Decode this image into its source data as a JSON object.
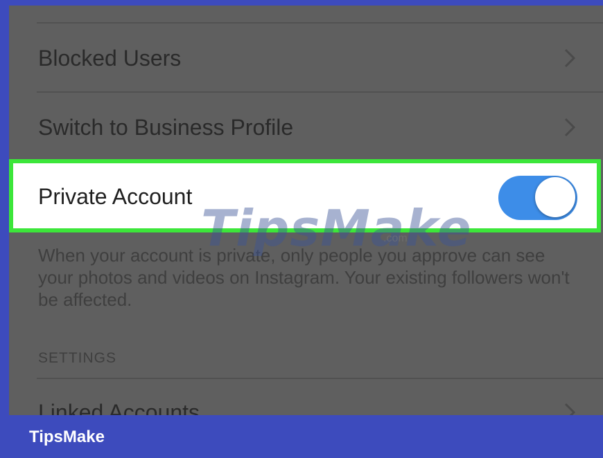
{
  "settings_rows": {
    "blocked_users": "Blocked Users",
    "switch_business": "Switch to Business Profile",
    "linked_accounts": "Linked Accounts"
  },
  "private_account": {
    "label": "Private Account",
    "toggle_state": "on",
    "description": "When your account is private, only people you approve can see your photos and videos on Instagram. Your existing followers won't be affected."
  },
  "section_header": "SETTINGS",
  "watermark": {
    "text": "TipsMake",
    "suffix": ".com"
  },
  "footer": {
    "brand": "TipsMake"
  },
  "colors": {
    "highlight_border": "#3ce63a",
    "toggle_on": "#3d8de8",
    "frame": "#3d4bbd"
  }
}
